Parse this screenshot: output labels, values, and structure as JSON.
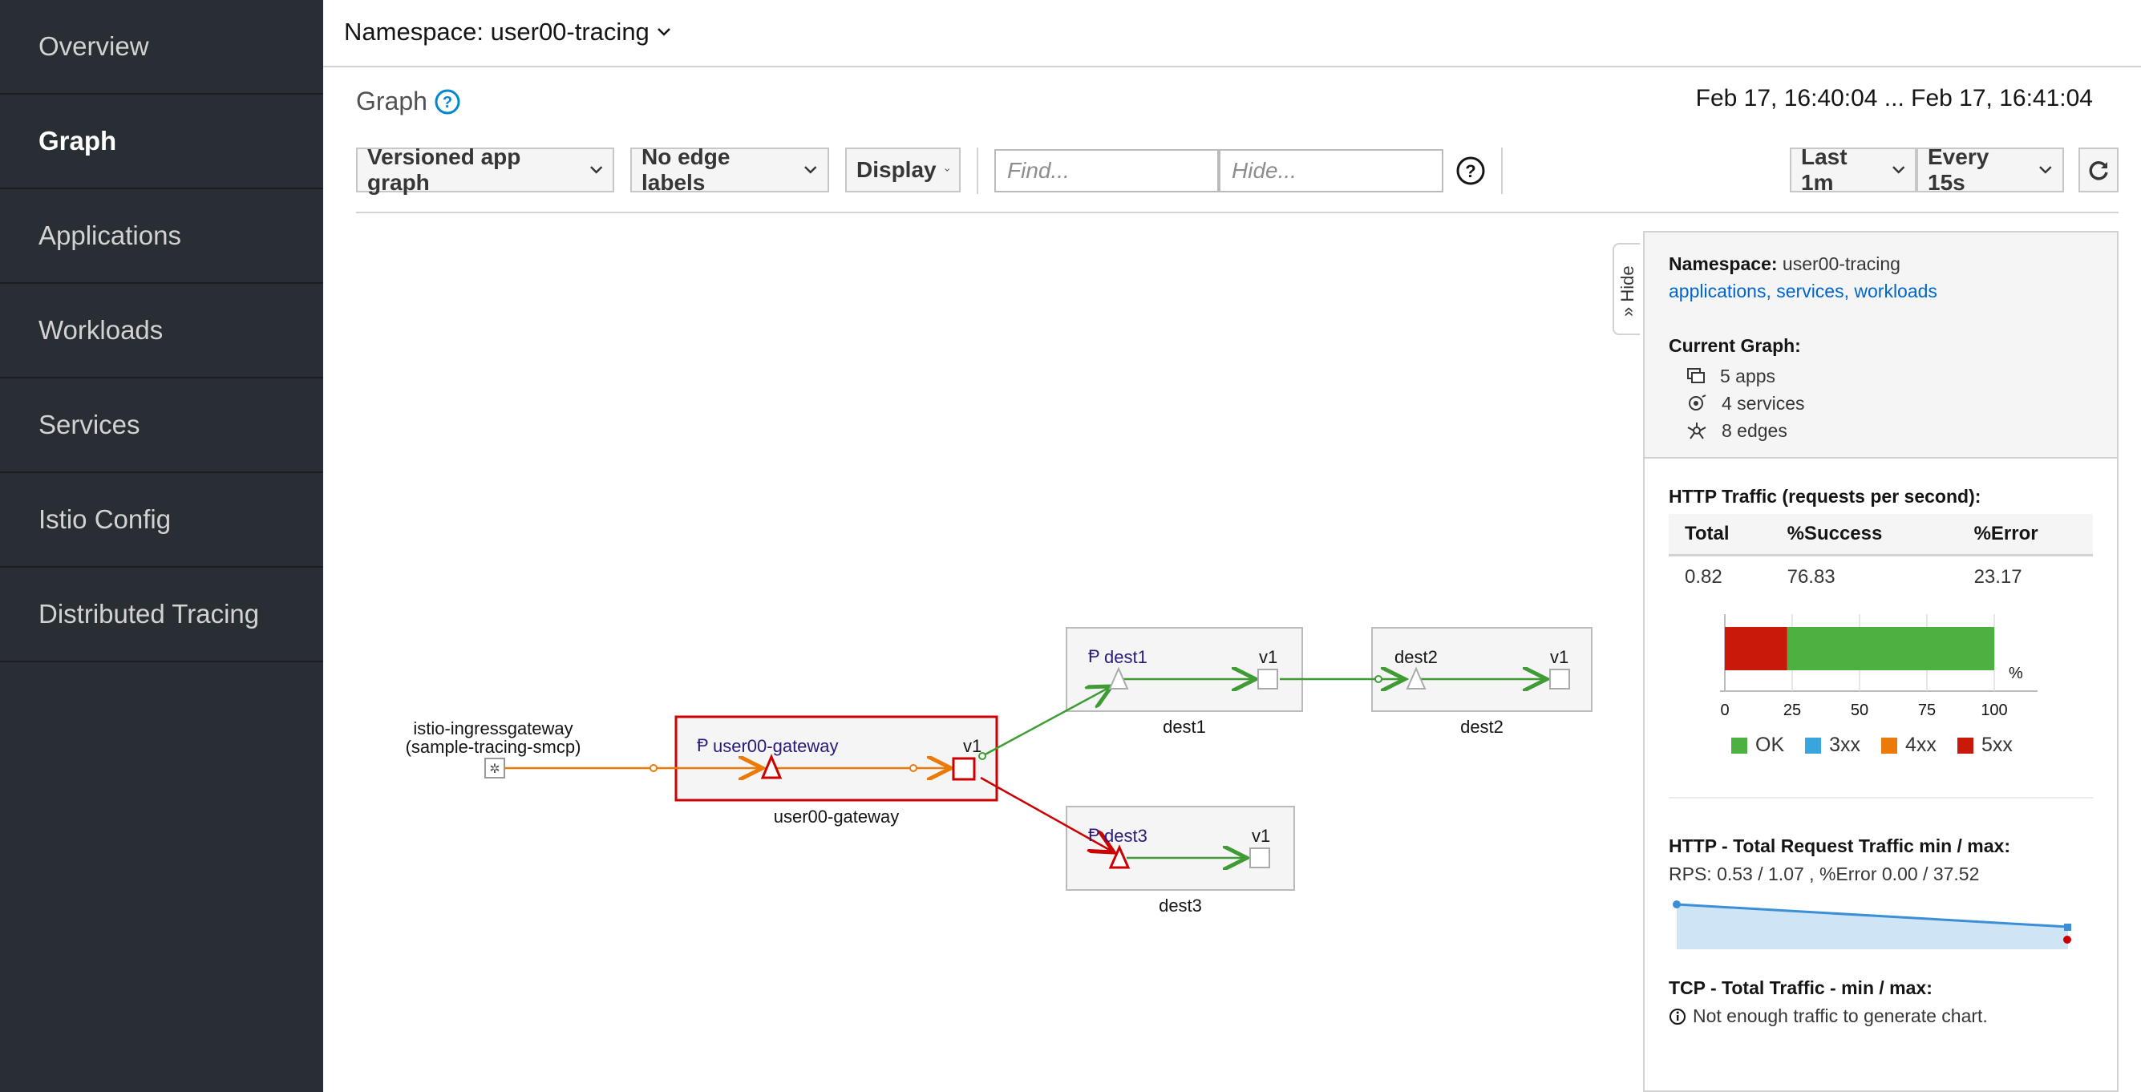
{
  "sidebar": {
    "items": [
      {
        "label": "Overview",
        "active": false
      },
      {
        "label": "Graph",
        "active": true
      },
      {
        "label": "Applications",
        "active": false
      },
      {
        "label": "Workloads",
        "active": false
      },
      {
        "label": "Services",
        "active": false
      },
      {
        "label": "Istio Config",
        "active": false
      },
      {
        "label": "Distributed Tracing",
        "active": false
      }
    ]
  },
  "header": {
    "namespace_label": "Namespace: user00-tracing"
  },
  "page": {
    "title": "Graph",
    "time_range": "Feb 17, 16:40:04 ... Feb 17, 16:41:04"
  },
  "toolbar": {
    "graph_type": "Versioned app graph",
    "edge_labels": "No edge labels",
    "display": "Display",
    "find_placeholder": "Find...",
    "hide_placeholder": "Hide...",
    "duration": "Last 1m",
    "refresh_interval": "Every 15s"
  },
  "graph": {
    "nodes": {
      "ingress_name": "istio-ingressgateway",
      "ingress_sub": "(sample-tracing-smcp)",
      "gateway_app": "user00-gateway",
      "gateway_version": "v1",
      "gateway_box": "user00-gateway",
      "dest1_app": "dest1",
      "dest1_version": "v1",
      "dest1_box": "dest1",
      "dest2_app": "dest2",
      "dest2_version": "v1",
      "dest2_box": "dest2",
      "dest3_app": "dest3",
      "dest3_version": "v1",
      "dest3_box": "dest3"
    },
    "colors": {
      "ok": "#3f9c35",
      "warning": "#ec7a08",
      "error": "#cc0000",
      "app": "#2b1a7a"
    }
  },
  "panel": {
    "hide_label": "Hide",
    "namespace_label": "Namespace:",
    "namespace_value": "user00-tracing",
    "ns_links": "applications, services, workloads",
    "current_graph_label": "Current Graph:",
    "apps": "5 apps",
    "services": "4 services",
    "edges": "8 edges",
    "http_title": "HTTP Traffic (requests per second):",
    "table": {
      "headers": [
        "Total",
        "%Success",
        "%Error"
      ],
      "row": [
        "0.82",
        "76.83",
        "23.17"
      ]
    },
    "bar_chart": {
      "ok_percent": 76.83,
      "error_percent": 23.17,
      "ticks": [
        "0",
        "25",
        "50",
        "75",
        "100"
      ],
      "unit": "%"
    },
    "legend": [
      "OK",
      "3xx",
      "4xx",
      "5xx"
    ],
    "legend_colors": [
      "#3f9c35",
      "#39a5dc",
      "#ec7a08",
      "#cc0000"
    ],
    "http_total_title": "HTTP - Total Request Traffic min / max:",
    "http_total_values": "RPS: 0.53 / 1.07 , %Error 0.00 / 37.52",
    "tcp_title": "TCP - Total Traffic - min / max:",
    "tcp_message": "Not enough traffic to generate chart."
  }
}
